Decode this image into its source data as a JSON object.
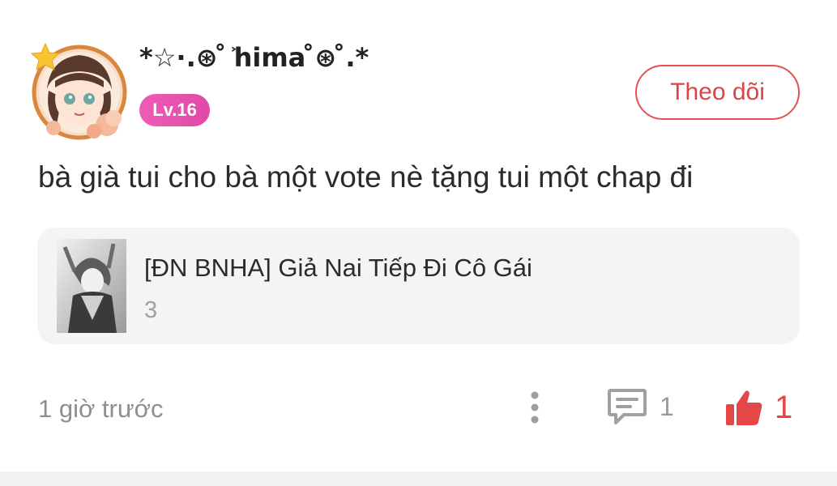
{
  "user": {
    "name": "*☆·.⊛ ̊ ͐hima ̊⊛ ̊.*",
    "level": "Lv.16",
    "follow_label": "Theo dõi"
  },
  "comment": {
    "text": "bà già tui cho bà một vote nè tặng tui một chap đi"
  },
  "story": {
    "title": "[ĐN BNHA] Giả Nai Tiếp Đi Cô Gái",
    "chapter": "3"
  },
  "footer": {
    "timestamp": "1 giờ trước",
    "reply_count": "1",
    "like_count": "1"
  },
  "icons": {
    "more": "more-vertical-icon",
    "comment": "comment-icon",
    "like": "thumbs-up-icon"
  },
  "colors": {
    "accent_red": "#e54747",
    "badge_pink": "#e84fae",
    "muted_text": "#8f8f8f",
    "card_bg": "#f4f4f4"
  }
}
